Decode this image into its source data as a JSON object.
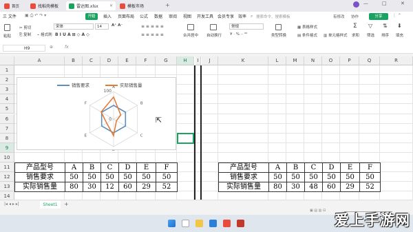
{
  "titlebar": {
    "tabs": [
      {
        "label": "找稻壳模板",
        "color": "#e74c3c"
      },
      {
        "label": "雷达图.xlsx",
        "color": "#1aa260"
      },
      {
        "label": "模板市场",
        "color": "#e74c3c"
      }
    ],
    "search_placeholder": "搜索命令、搜索模板",
    "share_label": "分享"
  },
  "menubar": {
    "file_label": "三 文件",
    "start_label": "开始",
    "items": [
      "插入",
      "页面布局",
      "公式",
      "数据",
      "审阅",
      "视图",
      "开发工具",
      "会员专享",
      "效率"
    ],
    "right_items": [
      "有修改",
      "协作"
    ]
  },
  "toolbar": {
    "paste": "粘贴",
    "cut": "剪切",
    "copy": "复制",
    "format_painter": "格式刷",
    "font_name": "宋体",
    "font_size": "14",
    "merge_center": "合并居中",
    "wrap_text": "自动换行",
    "number_format": "常规",
    "type_convert": "类型转换",
    "table_style": "表格样式",
    "conditional_format": "条件格式",
    "cell_style": "单元格样式",
    "sum": "求和",
    "filter": "筛选",
    "sort": "排序",
    "fill": "填充"
  },
  "formulabar": {
    "cell_ref": "H9",
    "fx": "fx"
  },
  "columns_left": [
    "A",
    "B",
    "C",
    "D",
    "E",
    "F",
    "G",
    "H"
  ],
  "columns_right": [
    "I",
    "J",
    "K",
    "L",
    "M",
    "N",
    "O",
    "P",
    "Q",
    "R"
  ],
  "rows": [
    "1",
    "2",
    "3",
    "4",
    "5",
    "6",
    "7",
    "8",
    "9",
    "10",
    "11",
    "12",
    "13",
    "14"
  ],
  "chart": {
    "legend": [
      "销售要求",
      "实际销售量"
    ],
    "series_colors": [
      "#5b8fbd",
      "#e07b39"
    ],
    "axis_max": "100",
    "axis_min": "0",
    "axis_labels": [
      "A",
      "B",
      "C",
      "D",
      "E",
      "F"
    ]
  },
  "chart_data": {
    "type": "radar",
    "categories": [
      "A",
      "B",
      "C",
      "D",
      "E",
      "F"
    ],
    "series": [
      {
        "name": "销售要求",
        "values": [
          50,
          50,
          50,
          50,
          50,
          50
        ]
      },
      {
        "name": "实际销售量",
        "values": [
          80,
          30,
          12,
          60,
          29,
          52
        ]
      }
    ],
    "ylim": [
      0,
      100
    ]
  },
  "table_left": {
    "header": [
      "产品型号",
      "A",
      "B",
      "C",
      "D",
      "E",
      "F"
    ],
    "rows": [
      [
        "销售要求",
        "50",
        "50",
        "50",
        "50",
        "50",
        "50"
      ],
      [
        "实际销售量",
        "80",
        "30",
        "12",
        "60",
        "29",
        "52"
      ]
    ]
  },
  "table_right": {
    "header": [
      "产品型号",
      "A",
      "B",
      "C",
      "D",
      "E",
      "F"
    ],
    "rows": [
      [
        "销售要求",
        "50",
        "50",
        "50",
        "50",
        "50",
        "50"
      ],
      [
        "实际销售量",
        "80",
        "30",
        "48",
        "60",
        "29",
        "52"
      ]
    ]
  },
  "sheetbar": {
    "sheet_tab": "Sheet1",
    "add": "+"
  },
  "watermark": "爱上手游网"
}
